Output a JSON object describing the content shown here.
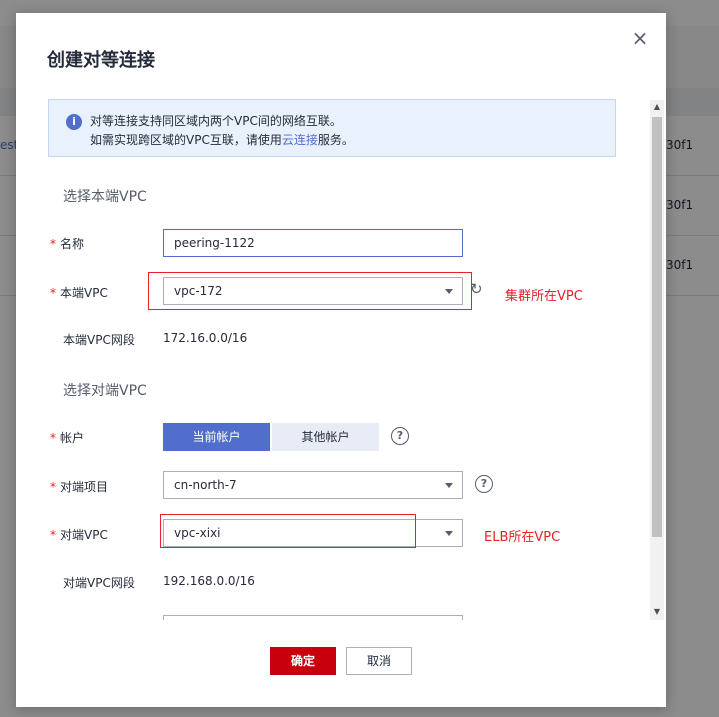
{
  "background": {
    "row_left_text": "est",
    "row_right_text": "30f1"
  },
  "dialog": {
    "title": "创建对等连接",
    "close_icon": "close-icon",
    "info": {
      "line1": "对等连接支持同区域内两个VPC间的网络互联。",
      "line2_prefix": "如需实现跨区域的VPC互联，请使用",
      "line2_link": "云连接",
      "line2_suffix": "服务。"
    },
    "local_section": {
      "title": "选择本端VPC",
      "name_label": "名称",
      "name_value": "peering-1122",
      "vpc_label": "本端VPC",
      "vpc_value": "vpc-172",
      "cidr_label": "本端VPC网段",
      "cidr_value": "172.16.0.0/16"
    },
    "peer_section": {
      "title": "选择对端VPC",
      "account_label": "帐户",
      "account_options": [
        "当前帐户",
        "其他帐户"
      ],
      "project_label": "对端项目",
      "project_value": "cn-north-7",
      "vpc_label": "对端VPC",
      "vpc_value": "vpc-xixi",
      "cidr_label": "对端VPC网段",
      "cidr_value": "192.168.0.0/16"
    },
    "annotations": {
      "local_vpc_note": "集群所在VPC",
      "peer_vpc_note": "ELB所在VPC"
    },
    "footer": {
      "ok_label": "确定",
      "cancel_label": "取消"
    },
    "colors": {
      "primary": "#526ecc",
      "danger": "#c7000b",
      "annotation": "#e6212a"
    }
  }
}
